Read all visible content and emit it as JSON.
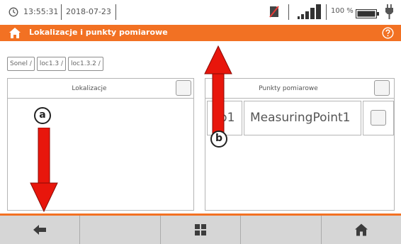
{
  "status_bar": {
    "time": "13:55:31",
    "date": "2018-07-23",
    "battery_percent": "100 %",
    "icons": [
      "clock-icon",
      "no-sd-card-icon",
      "signal-strength-icon",
      "battery-icon",
      "usb-plug-icon"
    ]
  },
  "title_bar": {
    "title": "Lokalizacje i punkty pomiarowe",
    "icons": [
      "home-icon",
      "help-icon"
    ],
    "color": "#f27123"
  },
  "breadcrumb": {
    "items": [
      "Sonel /",
      "loc1.3 /",
      "loc1.3.2 /"
    ]
  },
  "panels": {
    "locations": {
      "title": "Lokalizacje"
    },
    "points": {
      "title": "Punkty pomiarowe",
      "rows": [
        {
          "code": "pp1",
          "name": "MeasuringPoint1"
        }
      ]
    }
  },
  "annotations": {
    "a": "a",
    "b": "b",
    "arrow_color": "#e8160c"
  },
  "bottom_bar": {
    "buttons": [
      "back-icon",
      "",
      "grid-menu-icon",
      "",
      "home-icon"
    ]
  }
}
